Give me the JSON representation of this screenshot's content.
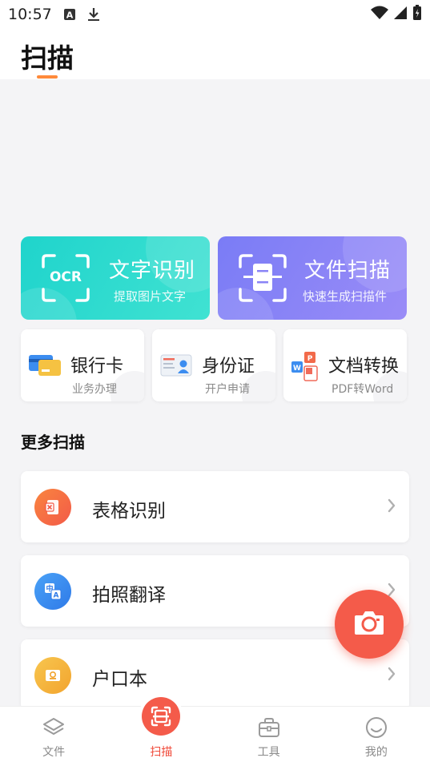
{
  "status_bar": {
    "time": "10:57",
    "notification_icons": [
      "a-badge-icon",
      "download-icon"
    ],
    "system_icons": [
      "wifi-icon",
      "signal-icon",
      "battery-charging-icon"
    ]
  },
  "header": {
    "title": "扫描",
    "accent_color": "#ff8a3a"
  },
  "feature_cards": [
    {
      "title": "文字识别",
      "subtitle": "提取图片文字",
      "icon_text": "OCR",
      "icon": "ocr-scan-icon",
      "color": "#1fd4cc"
    },
    {
      "title": "文件扫描",
      "subtitle": "快速生成扫描件",
      "icon": "document-scan-icon",
      "color": "#7a7cf6"
    }
  ],
  "quick_cards": [
    {
      "title": "银行卡",
      "subtitle": "业务办理",
      "icon": "bank-card-icon"
    },
    {
      "title": "身份证",
      "subtitle": "开户申请",
      "icon": "id-card-icon"
    },
    {
      "title": "文档转换",
      "subtitle": "PDF转Word",
      "icon": "document-convert-icon"
    }
  ],
  "more_section": {
    "title": "更多扫描",
    "items": [
      {
        "label": "表格识别",
        "icon": "table-excel-icon",
        "color": "#f4613f"
      },
      {
        "label": "拍照翻译",
        "icon": "translate-icon",
        "color": "#3c8df0"
      },
      {
        "label": "户口本",
        "icon": "household-register-icon",
        "color": "#f5b43c"
      }
    ]
  },
  "fab": {
    "icon": "camera-icon",
    "color": "#f45b4a"
  },
  "bottom_nav": {
    "items": [
      {
        "label": "文件",
        "icon": "layers-icon"
      },
      {
        "label": "扫描",
        "icon": "scan-icon",
        "active": true
      },
      {
        "label": "工具",
        "icon": "toolbox-icon"
      },
      {
        "label": "我的",
        "icon": "smile-face-icon"
      }
    ],
    "active_color": "#f04a3a"
  }
}
